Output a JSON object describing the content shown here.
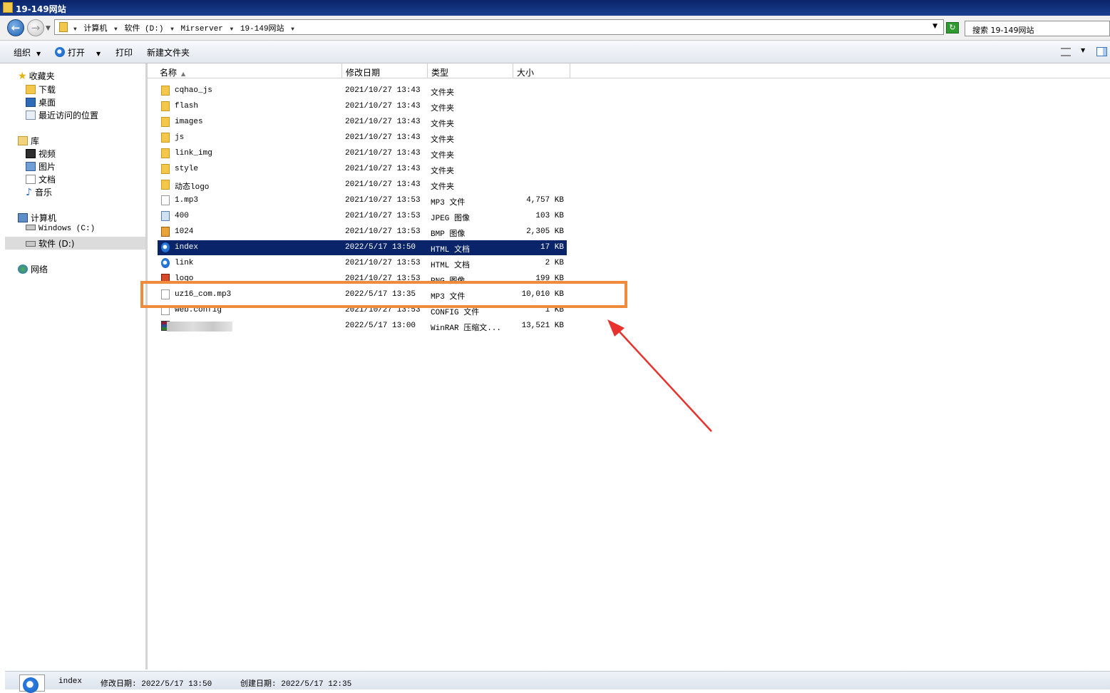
{
  "window": {
    "title": "19-149网站"
  },
  "address": {
    "crumbs": [
      "计算机",
      "软件 (D:)",
      "Mirserver",
      "19-149网站"
    ],
    "search_placeholder": "搜索 19-149网站"
  },
  "toolbar": {
    "organize": "组织",
    "open": "打开",
    "print": "打印",
    "new_folder": "新建文件夹"
  },
  "nav": {
    "favorites": "收藏夹",
    "downloads": "下载",
    "desktop": "桌面",
    "recent": "最近访问的位置",
    "libraries": "库",
    "videos": "视频",
    "pictures": "图片",
    "documents": "文档",
    "music": "音乐",
    "computer": "计算机",
    "drive_c": "Windows (C:)",
    "drive_d": "软件 (D:)",
    "network": "网络"
  },
  "columns": {
    "name": "名称",
    "date": "修改日期",
    "type": "类型",
    "size": "大小"
  },
  "files": [
    {
      "icon": "folder-icon",
      "name": "cqhao_js",
      "date": "2021/10/27 13:43",
      "type": "文件夹",
      "size": ""
    },
    {
      "icon": "folder-icon",
      "name": "flash",
      "date": "2021/10/27 13:43",
      "type": "文件夹",
      "size": ""
    },
    {
      "icon": "folder-icon",
      "name": "images",
      "date": "2021/10/27 13:43",
      "type": "文件夹",
      "size": ""
    },
    {
      "icon": "folder-icon",
      "name": "js",
      "date": "2021/10/27 13:43",
      "type": "文件夹",
      "size": ""
    },
    {
      "icon": "folder-icon",
      "name": "link_img",
      "date": "2021/10/27 13:43",
      "type": "文件夹",
      "size": ""
    },
    {
      "icon": "folder-icon",
      "name": "style",
      "date": "2021/10/27 13:43",
      "type": "文件夹",
      "size": ""
    },
    {
      "icon": "folder-icon",
      "name": "动态logo",
      "date": "2021/10/27 13:43",
      "type": "文件夹",
      "size": ""
    },
    {
      "icon": "file-icon",
      "name": "1.mp3",
      "date": "2021/10/27 13:53",
      "type": "MP3 文件",
      "size": "4,757 KB"
    },
    {
      "icon": "image-icon",
      "name": "400",
      "date": "2021/10/27 13:53",
      "type": "JPEG 图像",
      "size": "103 KB"
    },
    {
      "icon": "bmp-icon",
      "name": "1024",
      "date": "2021/10/27 13:53",
      "type": "BMP 图像",
      "size": "2,305 KB"
    },
    {
      "icon": "ie-icon",
      "name": "index",
      "date": "2022/5/17 13:50",
      "type": "HTML 文档",
      "size": "17 KB"
    },
    {
      "icon": "ie-icon",
      "name": "link",
      "date": "2021/10/27 13:53",
      "type": "HTML 文档",
      "size": "2 KB"
    },
    {
      "icon": "png-icon",
      "name": "logo",
      "date": "2021/10/27 13:53",
      "type": "PNG 图像",
      "size": "199 KB"
    },
    {
      "icon": "file-icon",
      "name": "uz16_com.mp3",
      "date": "2022/5/17 13:35",
      "type": "MP3 文件",
      "size": "10,010 KB"
    },
    {
      "icon": "file-icon",
      "name": "web.config",
      "date": "2021/10/27 13:53",
      "type": "CONFIG 文件",
      "size": "1 KB"
    },
    {
      "icon": "rar-icon",
      "name": "",
      "date": "2022/5/17 13:00",
      "type": "WinRAR 压缩文...",
      "size": "13,521 KB"
    }
  ],
  "selected_index": 10,
  "status": {
    "name": "index",
    "modified_label": "修改日期:",
    "modified": "2022/5/17 13:50",
    "created_label": "创建日期:",
    "created": "2022/5/17 12:35"
  },
  "colors": {
    "selection": "#0a246a",
    "highlight_box": "#f08a3c",
    "arrow": "#e8322d"
  }
}
